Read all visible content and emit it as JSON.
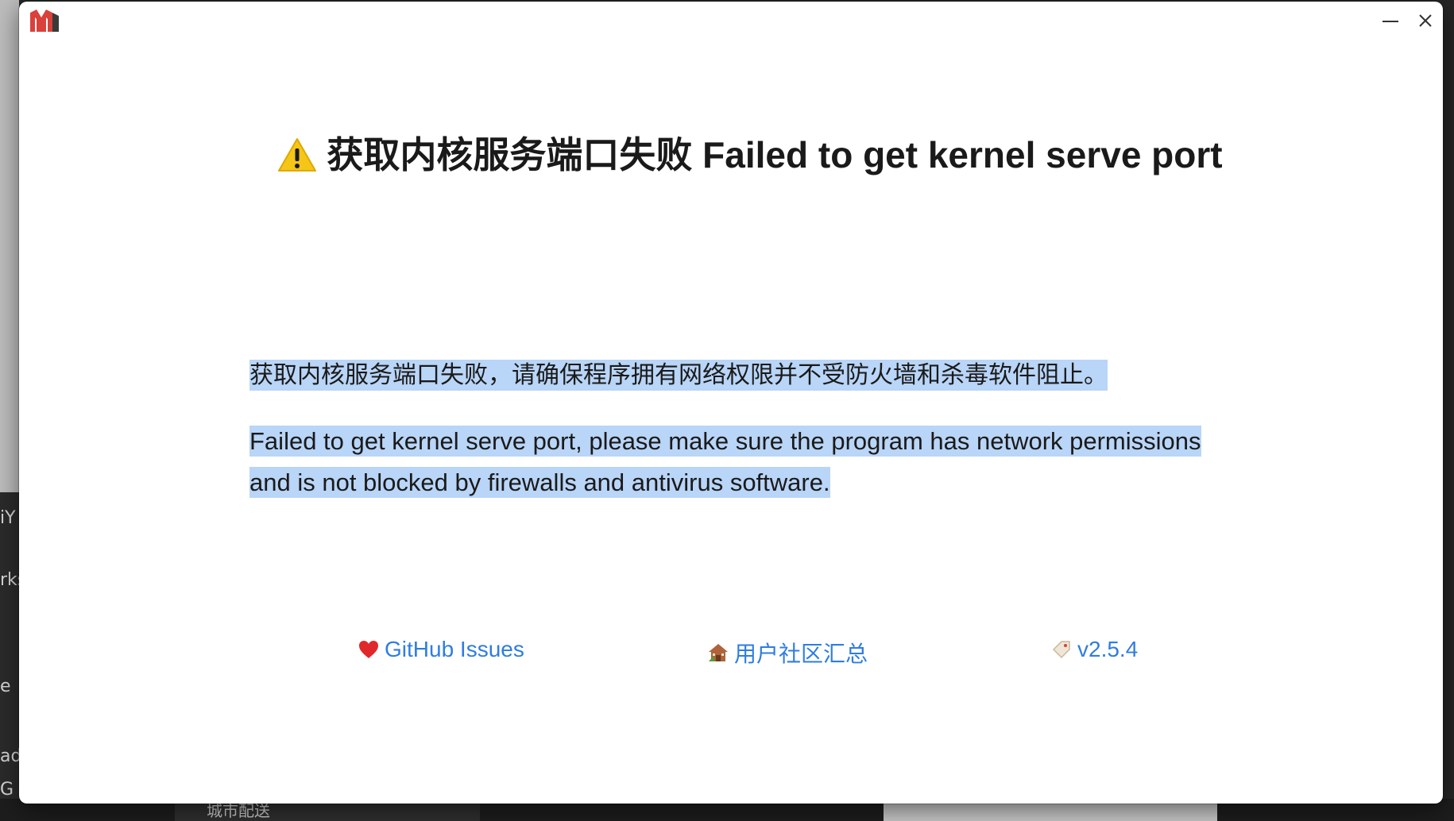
{
  "background": {
    "left_texts": [
      "iY",
      "rks",
      "e",
      "ad",
      "G"
    ],
    "bottom_tab_label": "城市配送"
  },
  "window": {
    "title": "获取内核服务端口失败 Failed to get kernel serve port",
    "title_icon": "warning-icon",
    "message_cn": "获取内核服务端口失败，请确保程序拥有网络权限并不受防火墙和杀毒软件阻止。",
    "message_en": "Failed to get kernel serve port, please make sure the program has network permissions and is not blocked by firewalls and antivirus software.",
    "links": {
      "github": {
        "label": "GitHub Issues",
        "icon": "heart-icon"
      },
      "community": {
        "label": "用户社区汇总",
        "icon": "house-icon"
      },
      "version": {
        "label": "v2.5.4",
        "icon": "tag-icon"
      }
    },
    "controls": {
      "minimize_icon": "minimize-icon",
      "close_icon": "close-icon"
    }
  },
  "colors": {
    "link": "#2f7de1",
    "highlight": "#b9d5f7",
    "logo_red": "#d9413a",
    "logo_dark": "#3a3a3a",
    "warning": "#f5c518"
  }
}
